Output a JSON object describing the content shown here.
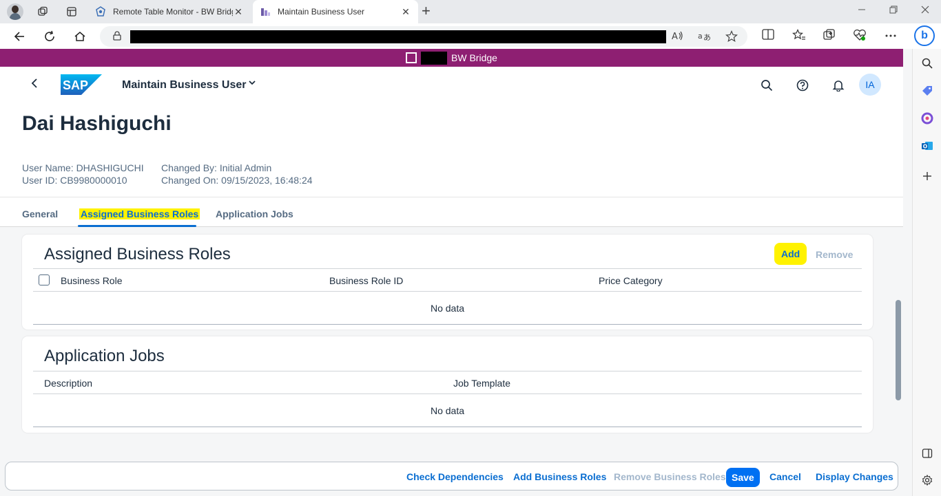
{
  "browser": {
    "tabs": [
      {
        "title": "Remote Table Monitor - BW Bridge",
        "active": false
      },
      {
        "title": "Maintain Business User",
        "active": true
      }
    ],
    "close_glyph": "✕",
    "new_tab_glyph": "+"
  },
  "system_banner": {
    "label": "BW Bridge",
    "color": "#8e1f72"
  },
  "shell": {
    "app_title": "Maintain Business User",
    "user_initials": "IA"
  },
  "object": {
    "title": "Dai Hashiguchi",
    "user_name": "User Name: DHASHIGUCHI",
    "user_id": "User ID: CB9980000010",
    "changed_by": "Changed By: Initial Admin",
    "changed_on": "Changed On: 09/15/2023, 16:48:24"
  },
  "tabs": [
    {
      "label": "General"
    },
    {
      "label": "Assigned Business Roles",
      "selected": true
    },
    {
      "label": "Application Jobs"
    }
  ],
  "roles_section": {
    "title": "Assigned Business Roles",
    "add_label": "Add",
    "remove_label": "Remove",
    "columns": [
      "Business Role",
      "Business Role ID",
      "Price Category"
    ],
    "no_data": "No data"
  },
  "jobs_section": {
    "title": "Application Jobs",
    "columns": [
      "Description",
      "Job Template"
    ],
    "no_data": "No data"
  },
  "footer": {
    "check_dependencies": "Check Dependencies",
    "add_business_roles": "Add Business Roles",
    "remove_business_roles": "Remove Business Roles",
    "save": "Save",
    "cancel": "Cancel",
    "display_changes": "Display Changes"
  },
  "colors": {
    "accent": "#0a6ed1",
    "primary_button": "#0070f2",
    "highlight": "#fff200"
  }
}
